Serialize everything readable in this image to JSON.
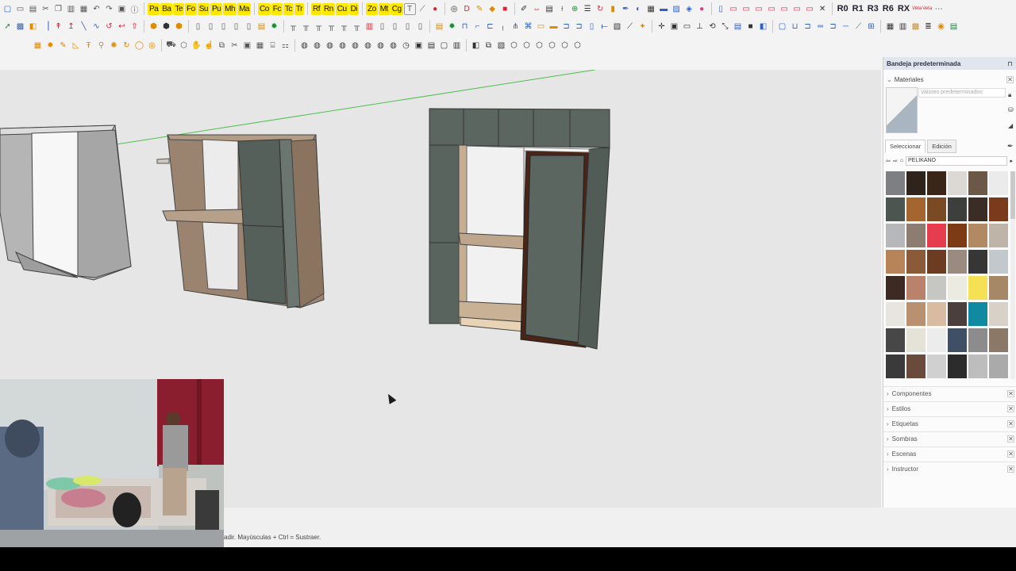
{
  "toolbar": {
    "row1_labels": [
      "Pa",
      "Ba",
      "Te",
      "Fo",
      "Su",
      "Pu",
      "Mh",
      "Ma",
      "Co",
      "Fc",
      "Tc",
      "Tr",
      "Rf",
      "Rn",
      "Cu",
      "Di",
      "Zo",
      "Mt",
      "Cg",
      "T"
    ],
    "right_labels": [
      "R0",
      "R1",
      "R3",
      "R6",
      "RX"
    ],
    "small_labels": [
      "Veta",
      "Veta"
    ]
  },
  "tray": {
    "title": "Bandeja predeterminada",
    "materials": {
      "heading": "Materiales",
      "name_value": "Valores predeterminados",
      "tabs": [
        "Seleccionar",
        "Edición"
      ],
      "library": "PELIKANO",
      "swatch_colors": [
        "#7d7f82",
        "#2e241c",
        "#3a2519",
        "#dcd9d4",
        "#6b5846",
        "#ebebeb",
        "#4d5550",
        "#a4652e",
        "#7a4a25",
        "#3d3f3c",
        "#3a2d26",
        "#7a3a1c",
        "#b6b7b9",
        "#8c7d70",
        "#e63d4e",
        "#7c3b14",
        "#b18a63",
        "#bfb4a8",
        "#b78359",
        "#8a5a39",
        "#6b3b22",
        "#9a8a80",
        "#363636",
        "#c3c8cd",
        "#3d2a22",
        "#b9836b",
        "#c6c6c2",
        "#ecebe1",
        "#f5e154",
        "#a68866",
        "#e7e5df",
        "#b99070",
        "#d8bba0",
        "#4a3f3c",
        "#0f8aa0",
        "#d7d1c8",
        "#474747",
        "#e5e2d8",
        "#ececec",
        "#3f4f66",
        "#8c8c8c",
        "#8c7867",
        "#3a3a3a",
        "#6a4a3a",
        "#d0d0d0",
        "#2c2c2c",
        "#bdbdbd",
        "#aaaaaa"
      ]
    },
    "sections": [
      "Componentes",
      "Estilos",
      "Etiquetas",
      "Sombras",
      "Escenas",
      "Instructor"
    ]
  },
  "status": {
    "text": "adir. Mayúsculas + Ctrl = Sustraer."
  }
}
